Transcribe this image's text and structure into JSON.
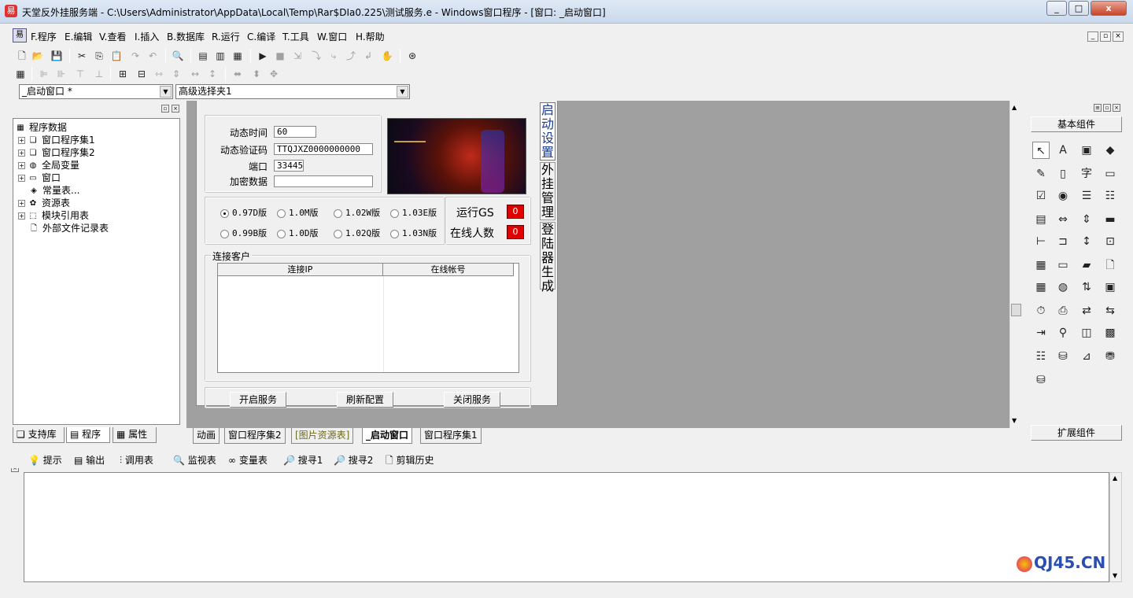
{
  "window": {
    "title": "天堂反外挂服务端 - C:\\Users\\Administrator\\AppData\\Local\\Temp\\Rar$DIa0.225\\测试服务.e - Windows窗口程序 - [窗口: _启动窗口]",
    "min": "_",
    "max": "□",
    "close": "x"
  },
  "menu": [
    "F.程序",
    "E.编辑",
    "V.查看",
    "I.插入",
    "B.数据库",
    "R.运行",
    "C.编译",
    "T.工具",
    "W.窗口",
    "H.帮助"
  ],
  "combos": {
    "window_select": "_启动窗口 *",
    "component_select": "高级选择夹1"
  },
  "tree": {
    "root": "程序数据",
    "items": [
      "窗口程序集1",
      "窗口程序集2",
      "全局变量",
      "窗口",
      "常量表...",
      "资源表",
      "模块引用表",
      "外部文件记录表"
    ]
  },
  "left_tabs": [
    "支持库",
    "程序",
    "属性"
  ],
  "form": {
    "fields": [
      {
        "label": "动态时间",
        "value": "60"
      },
      {
        "label": "动态验证码",
        "value": "TTQJXZ0000000000"
      },
      {
        "label": "端口",
        "value": "33445"
      },
      {
        "label": "加密数据",
        "value": ""
      }
    ],
    "versions": [
      "0.97D版",
      "1.0M版",
      "1.02W版",
      "1.03E版",
      "0.99B版",
      "1.0D版",
      "1.02Q版",
      "1.03N版"
    ],
    "selected_version": "0.97D版",
    "run_gs_label": "运行GS",
    "run_gs_value": "0",
    "online_label": "在线人数",
    "online_value": "0",
    "client_group": "连接客户",
    "columns": [
      "连接IP",
      "在线帐号"
    ],
    "buttons": [
      "开启服务",
      "刷新配置",
      "关闭服务"
    ],
    "vtabs": [
      "启动设置",
      "外挂管理",
      "登陆器生成"
    ]
  },
  "design_tabs": [
    "动画",
    "窗口程序集2",
    "[图片资源表]",
    "_启动窗口",
    "窗口程序集1"
  ],
  "palette": {
    "top_label": "基本组件",
    "bottom_label": "扩展组件"
  },
  "bottom_tabs": [
    "提示",
    "输出",
    "调用表",
    "监视表",
    "变量表",
    "搜寻1",
    "搜寻2",
    "剪辑历史"
  ],
  "watermark": "QJ45.CN"
}
